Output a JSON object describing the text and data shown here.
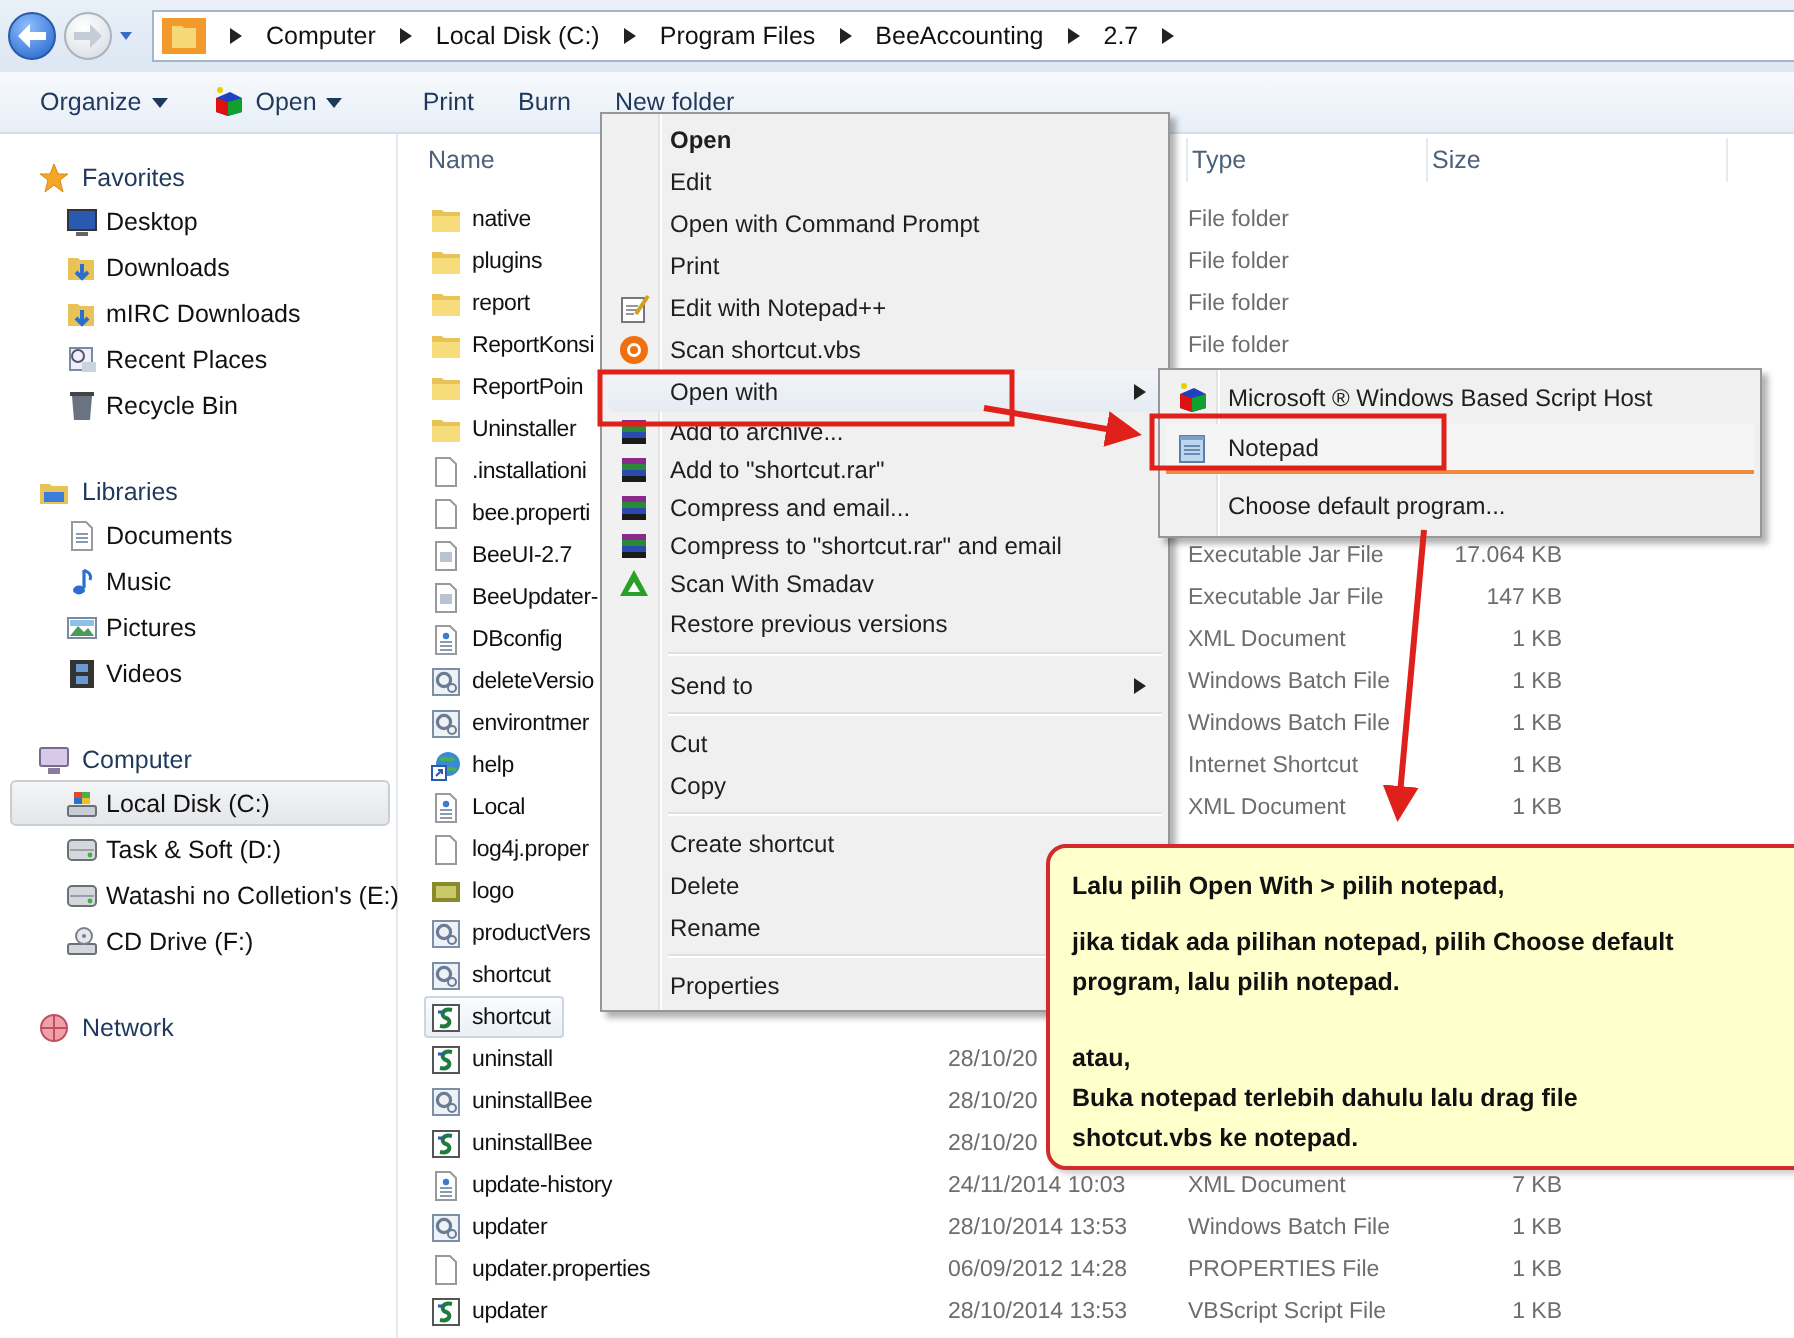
{
  "address_bar": {
    "crumbs": [
      "Computer",
      "Local Disk (C:)",
      "Program Files",
      "BeeAccounting",
      "2.7"
    ]
  },
  "toolbar": [
    {
      "label": "Organize",
      "kind": "dropdown"
    },
    {
      "label": "Open",
      "kind": "open-dropdown"
    },
    {
      "label": "Print",
      "kind": "plain"
    },
    {
      "label": "Burn",
      "kind": "plain"
    },
    {
      "label": "New folder",
      "kind": "plain"
    }
  ],
  "navigation": [
    {
      "label": "Favorites",
      "kind": "star",
      "items": [
        {
          "label": "Desktop",
          "kind": "desktop",
          "selected": false
        },
        {
          "label": "Downloads",
          "kind": "download",
          "selected": false
        },
        {
          "label": "mIRC Downloads",
          "kind": "download",
          "selected": false
        },
        {
          "label": "Recent Places",
          "kind": "recent",
          "selected": false
        },
        {
          "label": "Recycle Bin",
          "kind": "bin",
          "selected": false
        }
      ]
    },
    {
      "label": "Libraries",
      "kind": "library",
      "items": [
        {
          "label": "Documents",
          "kind": "document",
          "selected": false
        },
        {
          "label": "Music",
          "kind": "music",
          "selected": false
        },
        {
          "label": "Pictures",
          "kind": "pictures",
          "selected": false
        },
        {
          "label": "Videos",
          "kind": "video",
          "selected": false
        }
      ]
    },
    {
      "label": "Computer",
      "kind": "computer",
      "items": [
        {
          "label": "Local Disk (C:)",
          "kind": "system-disk",
          "selected": true
        },
        {
          "label": "Task & Soft (D:)",
          "kind": "disk",
          "selected": false
        },
        {
          "label": "Watashi no Colletion's (E:)",
          "kind": "disk",
          "selected": false
        },
        {
          "label": "CD Drive (F:)",
          "kind": "cd",
          "selected": false
        }
      ]
    },
    {
      "label": "Network",
      "kind": "network"
    }
  ],
  "file_list": {
    "columns": {
      "name": "Name",
      "type": "Type",
      "size": "Size"
    },
    "rows": [
      {
        "name": "native",
        "kind": "folder",
        "type": "File folder",
        "selected": false
      },
      {
        "name": "plugins",
        "kind": "folder",
        "type": "File folder",
        "selected": false
      },
      {
        "name": "report",
        "kind": "folder",
        "type": "File folder",
        "selected": false
      },
      {
        "name": "ReportKonsi",
        "kind": "folder",
        "type": "File folder",
        "selected": false
      },
      {
        "name": "ReportPoin",
        "kind": "folder",
        "selected": false
      },
      {
        "name": "Uninstaller",
        "kind": "folder",
        "selected": false
      },
      {
        "name": ".installationi",
        "kind": "blank",
        "selected": false
      },
      {
        "name": "bee.properti",
        "kind": "blank",
        "selected": false
      },
      {
        "name": "BeeUI-2.7",
        "kind": "image-doc",
        "type": "Executable Jar File",
        "size": "17.064 KB",
        "selected": false
      },
      {
        "name": "BeeUpdater-",
        "kind": "image-doc",
        "type": "Executable Jar File",
        "size": "147 KB",
        "selected": false
      },
      {
        "name": "DBconfig",
        "kind": "xml",
        "type": "XML Document",
        "size": "1 KB",
        "selected": false
      },
      {
        "name": "deleteVersio",
        "kind": "batch",
        "type": "Windows Batch File",
        "size": "1 KB",
        "selected": false
      },
      {
        "name": "environtmer",
        "kind": "batch",
        "type": "Windows Batch File",
        "size": "1 KB",
        "selected": false
      },
      {
        "name": "help",
        "kind": "url",
        "type": "Internet Shortcut",
        "size": "1 KB",
        "selected": false
      },
      {
        "name": "Local",
        "kind": "xml",
        "type": "XML Document",
        "size": "1 KB",
        "selected": false
      },
      {
        "name": "log4j.proper",
        "kind": "blank",
        "selected": false
      },
      {
        "name": "logo",
        "kind": "jpg",
        "selected": false
      },
      {
        "name": "productVers",
        "kind": "batch",
        "selected": false
      },
      {
        "name": "shortcut",
        "kind": "batch",
        "selected": false
      },
      {
        "name": "shortcut",
        "kind": "vbs",
        "selected": true
      },
      {
        "name": "uninstall",
        "kind": "vbs",
        "date": "28/10/20",
        "selected": false
      },
      {
        "name": "uninstallBee",
        "kind": "batch",
        "date": "28/10/20",
        "selected": false
      },
      {
        "name": "uninstallBee",
        "kind": "vbs",
        "date": "28/10/20",
        "selected": false
      },
      {
        "name": "update-history",
        "kind": "xml",
        "date": "24/11/2014 10:03",
        "type": "XML Document",
        "size": "7 KB",
        "selected": false
      },
      {
        "name": "updater",
        "kind": "batch",
        "date": "28/10/2014 13:53",
        "type": "Windows Batch File",
        "size": "1 KB",
        "selected": false
      },
      {
        "name": "updater.properties",
        "kind": "blank",
        "date": "06/09/2012 14:28",
        "type": "PROPERTIES File",
        "size": "1 KB",
        "selected": false
      },
      {
        "name": "updater",
        "kind": "vbs",
        "date": "28/10/2014 13:53",
        "type": "VBScript Script File",
        "size": "1 KB",
        "selected": false
      }
    ]
  },
  "context_menu": [
    {
      "kind": "plain",
      "label": "Open",
      "default": true,
      "highlighted": false,
      "submenu": false
    },
    {
      "kind": "plain",
      "label": "Edit",
      "default": false,
      "highlighted": false,
      "submenu": false
    },
    {
      "kind": "plain",
      "label": "Open with Command Prompt",
      "default": false,
      "highlighted": false,
      "submenu": false
    },
    {
      "kind": "plain",
      "label": "Print",
      "default": false,
      "highlighted": false,
      "submenu": false
    },
    {
      "kind": "notepad-edit",
      "label": "Edit with Notepad++",
      "default": false,
      "highlighted": false,
      "submenu": false
    },
    {
      "kind": "scan",
      "label": "Scan shortcut.vbs",
      "default": false,
      "highlighted": false,
      "submenu": false
    },
    {
      "kind": "plain",
      "label": "Open with",
      "default": false,
      "highlighted": true,
      "submenu": true
    },
    {
      "kind": "archive",
      "label": "Add to archive...",
      "default": false,
      "highlighted": false,
      "submenu": false
    },
    {
      "kind": "archive",
      "label": "Add to \"shortcut.rar\"",
      "default": false,
      "highlighted": false,
      "submenu": false
    },
    {
      "kind": "archive",
      "label": "Compress and email...",
      "default": false,
      "highlighted": false,
      "submenu": false
    },
    {
      "kind": "archive",
      "label": "Compress to \"shortcut.rar\" and email",
      "default": false,
      "highlighted": false,
      "submenu": false
    },
    {
      "kind": "smadav",
      "label": "Scan With Smadav",
      "default": false,
      "highlighted": false,
      "submenu": false
    },
    {
      "kind": "plain",
      "label": "Restore previous versions",
      "default": false,
      "highlighted": false,
      "submenu": false
    },
    {
      "kind": "separator"
    },
    {
      "kind": "plain",
      "label": "Send to",
      "default": false,
      "highlighted": false,
      "submenu": true
    },
    {
      "kind": "separator"
    },
    {
      "kind": "plain",
      "label": "Cut",
      "default": false,
      "highlighted": false,
      "submenu": false
    },
    {
      "kind": "plain",
      "label": "Copy",
      "default": false,
      "highlighted": false,
      "submenu": false
    },
    {
      "kind": "separator"
    },
    {
      "kind": "plain",
      "label": "Create shortcut",
      "default": false,
      "highlighted": false,
      "submenu": false
    },
    {
      "kind": "plain",
      "label": "Delete",
      "default": false,
      "highlighted": false,
      "submenu": false
    },
    {
      "kind": "plain",
      "label": "Rename",
      "default": false,
      "highlighted": false,
      "submenu": false
    },
    {
      "kind": "separator"
    },
    {
      "kind": "plain",
      "label": "Properties",
      "default": false,
      "highlighted": false,
      "submenu": false
    }
  ],
  "open_with_menu": [
    {
      "kind": "script-host",
      "label": "Microsoft ® Windows Based Script Host",
      "highlighted": false
    },
    {
      "kind": "notepad",
      "label": "Notepad",
      "highlighted": true
    },
    {
      "kind": "separator"
    },
    {
      "kind": "plain",
      "label": "Choose default program...",
      "highlighted": false
    }
  ],
  "callout": {
    "paragraphs": [
      [
        "Lalu pilih Open With > pilih notepad,"
      ],
      [
        "jika tidak ada pilihan notepad, pilih Choose default program, lalu pilih notepad."
      ],
      [
        "atau,",
        "Buka notepad terlebih dahulu lalu drag file shotcut.vbs ke notepad."
      ]
    ]
  }
}
